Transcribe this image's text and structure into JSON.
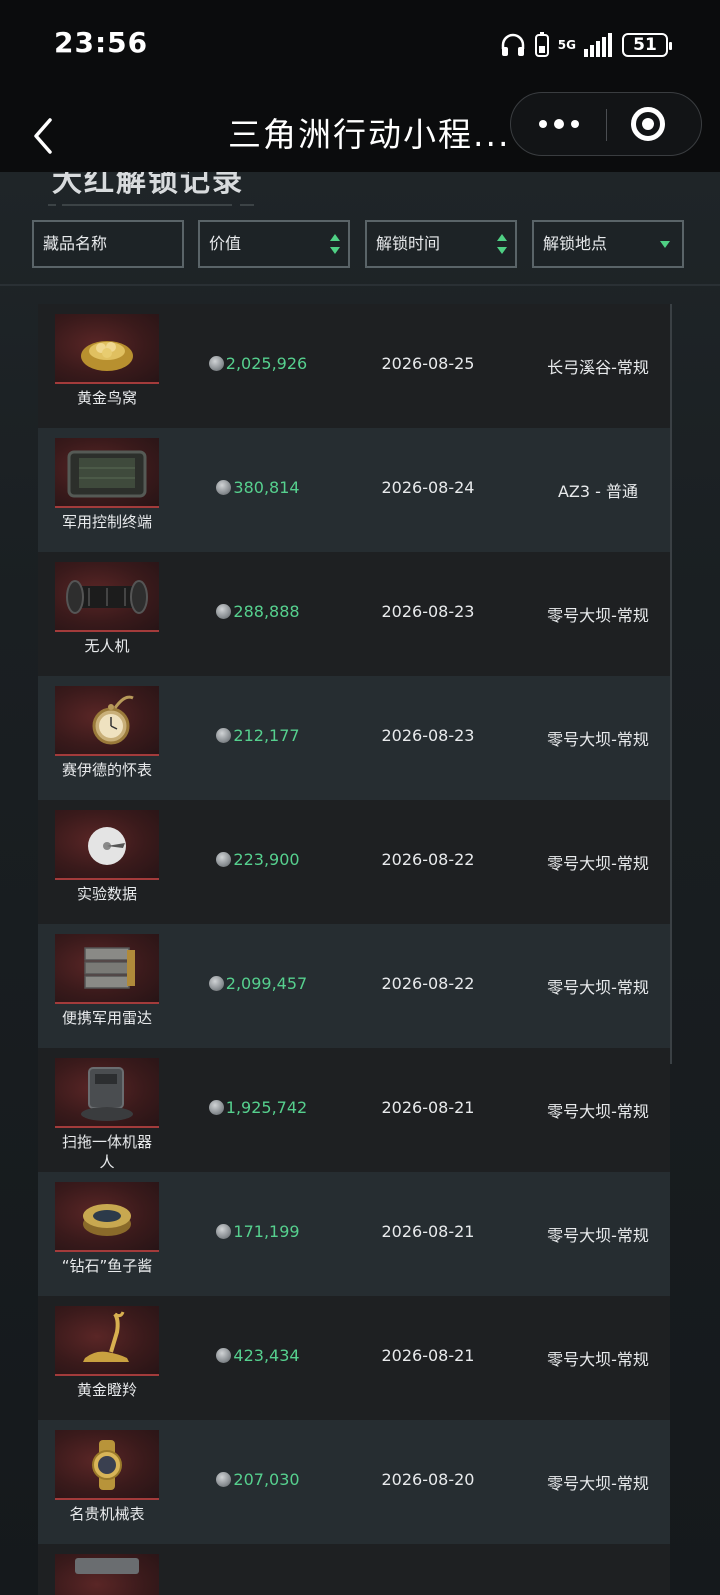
{
  "status_bar": {
    "time": "23:56",
    "network": "5G",
    "battery": "51"
  },
  "nav": {
    "title": "三角洲行动小程..."
  },
  "section": {
    "title": "大红解锁记录"
  },
  "filters": [
    {
      "label": "藏品名称",
      "indicator": "none"
    },
    {
      "label": "价值",
      "indicator": "sort"
    },
    {
      "label": "解锁时间",
      "indicator": "sort"
    },
    {
      "label": "解锁地点",
      "indicator": "dropdown"
    }
  ],
  "rows": [
    {
      "name": "黄金鸟窝",
      "value": "2,025,926",
      "date": "2026-08-25",
      "place": "长弓溪谷-常规",
      "icon": "golden-nest-icon"
    },
    {
      "name": "军用控制终端",
      "value": "380,814",
      "date": "2026-08-24",
      "place": "AZ3 - 普通",
      "icon": "military-terminal-icon"
    },
    {
      "name": "无人机",
      "value": "288,888",
      "date": "2026-08-23",
      "place": "零号大坝-常规",
      "icon": "drone-icon"
    },
    {
      "name": "赛伊德的怀表",
      "value": "212,177",
      "date": "2026-08-23",
      "place": "零号大坝-常规",
      "icon": "pocket-watch-icon"
    },
    {
      "name": "实验数据",
      "value": "223,900",
      "date": "2026-08-22",
      "place": "零号大坝-常规",
      "icon": "data-disc-icon"
    },
    {
      "name": "便携军用雷达",
      "value": "2,099,457",
      "date": "2026-08-22",
      "place": "零号大坝-常规",
      "icon": "radar-icon"
    },
    {
      "name": "扫拖一体机器人",
      "value": "1,925,742",
      "date": "2026-08-21",
      "place": "零号大坝-常规",
      "icon": "robot-vacuum-icon"
    },
    {
      "name": "“钻石”鱼子酱",
      "value": "171,199",
      "date": "2026-08-21",
      "place": "零号大坝-常规",
      "icon": "caviar-tin-icon"
    },
    {
      "name": "黄金瞪羚",
      "value": "423,434",
      "date": "2026-08-21",
      "place": "零号大坝-常规",
      "icon": "golden-gazelle-icon"
    },
    {
      "name": "名贵机械表",
      "value": "207,030",
      "date": "2026-08-20",
      "place": "零号大坝-常规",
      "icon": "luxury-watch-icon"
    },
    {
      "name": "",
      "value": "",
      "date": "",
      "place": "",
      "icon": "partial-item-icon"
    }
  ],
  "colors": {
    "value_green": "#56d08e",
    "accent_red": "#a33b3b",
    "row_dark": "#1e2022",
    "row_light": "#262d31"
  }
}
